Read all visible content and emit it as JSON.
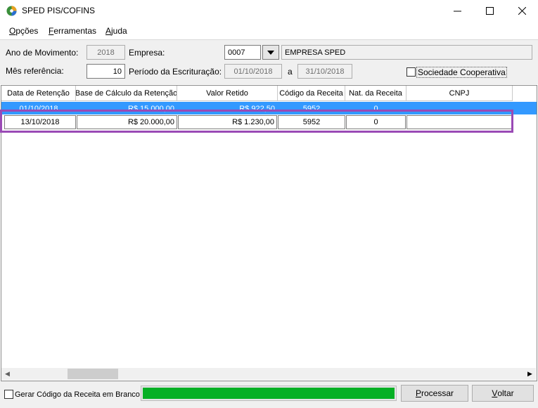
{
  "window": {
    "title": "SPED PIS/COFINS",
    "minimize_glyph": "—",
    "maximize_glyph": "☐",
    "close_glyph": "✕"
  },
  "menu": [
    {
      "label": "Opções",
      "underline": "O",
      "rest": "pções"
    },
    {
      "label": "Ferramentas",
      "underline": "F",
      "rest": "erramentas"
    },
    {
      "label": "Ajuda",
      "underline": "A",
      "rest": "juda"
    }
  ],
  "form": {
    "ano_label": "Ano de Movimento:",
    "ano_value": "2018",
    "empresa_label": "Empresa:",
    "empresa_code": "0007",
    "empresa_name": "EMPRESA SPED",
    "mes_label": "Mês referência:",
    "mes_value": "10",
    "periodo_label": "Período da Escrituração:",
    "periodo_start": "01/10/2018",
    "periodo_sep": "a",
    "periodo_end": "31/10/2018",
    "cooperativa_label": "Sociedade Cooperativa",
    "cooperativa_checked": false
  },
  "grid": {
    "columns": [
      "Data de Retenção",
      "Base de Cálculo da Retenção",
      "Valor Retido",
      "Código da Receita",
      "Nat. da Receita",
      "CNPJ"
    ],
    "rows": [
      [
        "01/10/2018",
        "R$ 15.000,00",
        "R$ 922,50",
        "5952",
        "0",
        ""
      ],
      [
        "13/10/2018",
        "R$ 20.000,00",
        "R$ 1.230,00",
        "5952",
        "0",
        ""
      ]
    ]
  },
  "scrollbar": {
    "left_glyph": "◀",
    "right_glyph": "▶"
  },
  "footer": {
    "gerar_label": "Gerar Código da Receita em Branco",
    "gerar_checked": false,
    "progress": 1.0,
    "progress_color": "#06b025",
    "processar_label": "Processar",
    "processar_underline": "P",
    "processar_rest": "rocessar",
    "voltar_label": "Voltar",
    "voltar_underline": "V",
    "voltar_rest": "oltar"
  },
  "colors": {
    "selection": "#3399ff",
    "highlight_border": "#9a4ab5"
  }
}
